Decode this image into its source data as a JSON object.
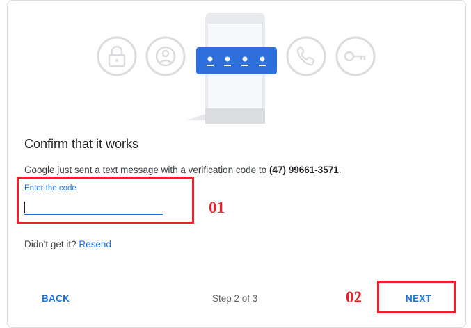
{
  "illustration": {
    "icons": [
      "lock-icon",
      "account-icon",
      "phone-call-icon",
      "key-icon"
    ],
    "code_dots": 4,
    "accent_color": "#2f6fdc",
    "icon_color": "#dadce0"
  },
  "title": "Confirm that it works",
  "description": {
    "text": "Google just sent a text message with a verification code to ",
    "phone": "(47) 99661-3571",
    "suffix": "."
  },
  "code_field": {
    "label": "Enter the code",
    "value": ""
  },
  "resend": {
    "prompt": "Didn't get it?",
    "link": "Resend"
  },
  "footer": {
    "back_label": "BACK",
    "step_text": "Step 2 of 3",
    "next_label": "NEXT"
  },
  "annotations": {
    "label_1": "01",
    "label_2": "02",
    "color": "#e8212b"
  }
}
